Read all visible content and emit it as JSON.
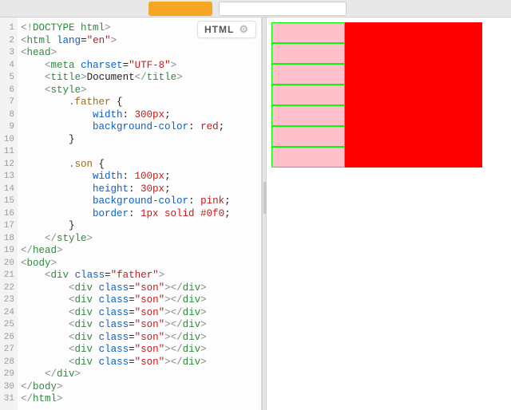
{
  "badge": {
    "label": "HTML"
  },
  "codeLines": [
    [
      [
        "b",
        "<!"
      ],
      [
        "t",
        "DOCTYPE html"
      ],
      [
        "b",
        ">"
      ]
    ],
    [
      [
        "b",
        "<"
      ],
      [
        "t",
        "html"
      ],
      [
        "txt",
        " "
      ],
      [
        "an",
        "lang"
      ],
      [
        "txt",
        "="
      ],
      [
        "av",
        "\"en\""
      ],
      [
        "b",
        ">"
      ]
    ],
    [
      [
        "b",
        "<"
      ],
      [
        "t",
        "head"
      ],
      [
        "b",
        ">"
      ]
    ],
    [
      [
        "txt",
        "    "
      ],
      [
        "b",
        "<"
      ],
      [
        "t",
        "meta"
      ],
      [
        "txt",
        " "
      ],
      [
        "an",
        "charset"
      ],
      [
        "txt",
        "="
      ],
      [
        "av",
        "\"UTF-8\""
      ],
      [
        "b",
        ">"
      ]
    ],
    [
      [
        "txt",
        "    "
      ],
      [
        "b",
        "<"
      ],
      [
        "t",
        "title"
      ],
      [
        "b",
        ">"
      ],
      [
        "txt",
        "Document"
      ],
      [
        "b",
        "</"
      ],
      [
        "t",
        "title"
      ],
      [
        "b",
        ">"
      ]
    ],
    [
      [
        "txt",
        "    "
      ],
      [
        "b",
        "<"
      ],
      [
        "t",
        "style"
      ],
      [
        "b",
        ">"
      ]
    ],
    [
      [
        "txt",
        "        "
      ],
      [
        "sel",
        ".father"
      ],
      [
        "txt",
        " {"
      ]
    ],
    [
      [
        "txt",
        "            "
      ],
      [
        "pr",
        "width"
      ],
      [
        "txt",
        ": "
      ],
      [
        "pv",
        "300px"
      ],
      [
        "txt",
        ";"
      ]
    ],
    [
      [
        "txt",
        "            "
      ],
      [
        "pr",
        "background-color"
      ],
      [
        "txt",
        ": "
      ],
      [
        "pv",
        "red"
      ],
      [
        "txt",
        ";"
      ]
    ],
    [
      [
        "txt",
        "        }"
      ]
    ],
    [
      [
        "txt",
        ""
      ]
    ],
    [
      [
        "txt",
        "        "
      ],
      [
        "sel",
        ".son"
      ],
      [
        "txt",
        " {"
      ]
    ],
    [
      [
        "txt",
        "            "
      ],
      [
        "pr",
        "width"
      ],
      [
        "txt",
        ": "
      ],
      [
        "pv",
        "100px"
      ],
      [
        "txt",
        ";"
      ]
    ],
    [
      [
        "txt",
        "            "
      ],
      [
        "pr",
        "height"
      ],
      [
        "txt",
        ": "
      ],
      [
        "pv",
        "30px"
      ],
      [
        "txt",
        ";"
      ]
    ],
    [
      [
        "txt",
        "            "
      ],
      [
        "pr",
        "background-color"
      ],
      [
        "txt",
        ": "
      ],
      [
        "pv",
        "pink"
      ],
      [
        "txt",
        ";"
      ]
    ],
    [
      [
        "txt",
        "            "
      ],
      [
        "pr",
        "border"
      ],
      [
        "txt",
        ": "
      ],
      [
        "pv",
        "1px solid #0f0"
      ],
      [
        "txt",
        ";"
      ]
    ],
    [
      [
        "txt",
        "        }"
      ]
    ],
    [
      [
        "txt",
        "    "
      ],
      [
        "b",
        "</"
      ],
      [
        "t",
        "style"
      ],
      [
        "b",
        ">"
      ]
    ],
    [
      [
        "b",
        "</"
      ],
      [
        "t",
        "head"
      ],
      [
        "b",
        ">"
      ]
    ],
    [
      [
        "b",
        "<"
      ],
      [
        "t",
        "body"
      ],
      [
        "b",
        ">"
      ]
    ],
    [
      [
        "txt",
        "    "
      ],
      [
        "b",
        "<"
      ],
      [
        "t",
        "div"
      ],
      [
        "txt",
        " "
      ],
      [
        "an",
        "class"
      ],
      [
        "txt",
        "="
      ],
      [
        "av",
        "\"father\""
      ],
      [
        "b",
        ">"
      ]
    ],
    [
      [
        "txt",
        "        "
      ],
      [
        "b",
        "<"
      ],
      [
        "t",
        "div"
      ],
      [
        "txt",
        " "
      ],
      [
        "an",
        "class"
      ],
      [
        "txt",
        "="
      ],
      [
        "av",
        "\"son\""
      ],
      [
        "b",
        "></"
      ],
      [
        "t",
        "div"
      ],
      [
        "b",
        ">"
      ]
    ],
    [
      [
        "txt",
        "        "
      ],
      [
        "b",
        "<"
      ],
      [
        "t",
        "div"
      ],
      [
        "txt",
        " "
      ],
      [
        "an",
        "class"
      ],
      [
        "txt",
        "="
      ],
      [
        "av",
        "\"son\""
      ],
      [
        "b",
        "></"
      ],
      [
        "t",
        "div"
      ],
      [
        "b",
        ">"
      ]
    ],
    [
      [
        "txt",
        "        "
      ],
      [
        "b",
        "<"
      ],
      [
        "t",
        "div"
      ],
      [
        "txt",
        " "
      ],
      [
        "an",
        "class"
      ],
      [
        "txt",
        "="
      ],
      [
        "av",
        "\"son\""
      ],
      [
        "b",
        "></"
      ],
      [
        "t",
        "div"
      ],
      [
        "b",
        ">"
      ]
    ],
    [
      [
        "txt",
        "        "
      ],
      [
        "b",
        "<"
      ],
      [
        "t",
        "div"
      ],
      [
        "txt",
        " "
      ],
      [
        "an",
        "class"
      ],
      [
        "txt",
        "="
      ],
      [
        "av",
        "\"son\""
      ],
      [
        "b",
        "></"
      ],
      [
        "t",
        "div"
      ],
      [
        "b",
        ">"
      ]
    ],
    [
      [
        "txt",
        "        "
      ],
      [
        "b",
        "<"
      ],
      [
        "t",
        "div"
      ],
      [
        "txt",
        " "
      ],
      [
        "an",
        "class"
      ],
      [
        "txt",
        "="
      ],
      [
        "av",
        "\"son\""
      ],
      [
        "b",
        "></"
      ],
      [
        "t",
        "div"
      ],
      [
        "b",
        ">"
      ]
    ],
    [
      [
        "txt",
        "        "
      ],
      [
        "b",
        "<"
      ],
      [
        "t",
        "div"
      ],
      [
        "txt",
        " "
      ],
      [
        "an",
        "class"
      ],
      [
        "txt",
        "="
      ],
      [
        "av",
        "\"son\""
      ],
      [
        "b",
        "></"
      ],
      [
        "t",
        "div"
      ],
      [
        "b",
        ">"
      ]
    ],
    [
      [
        "txt",
        "        "
      ],
      [
        "b",
        "<"
      ],
      [
        "t",
        "div"
      ],
      [
        "txt",
        " "
      ],
      [
        "an",
        "class"
      ],
      [
        "txt",
        "="
      ],
      [
        "av",
        "\"son\""
      ],
      [
        "b",
        "></"
      ],
      [
        "t",
        "div"
      ],
      [
        "b",
        ">"
      ]
    ],
    [
      [
        "txt",
        "    "
      ],
      [
        "b",
        "</"
      ],
      [
        "t",
        "div"
      ],
      [
        "b",
        ">"
      ]
    ],
    [
      [
        "b",
        "</"
      ],
      [
        "t",
        "body"
      ],
      [
        "b",
        ">"
      ]
    ],
    [
      [
        "b",
        "</"
      ],
      [
        "t",
        "html"
      ],
      [
        "b",
        ">"
      ]
    ]
  ],
  "preview": {
    "sonCount": 7
  }
}
